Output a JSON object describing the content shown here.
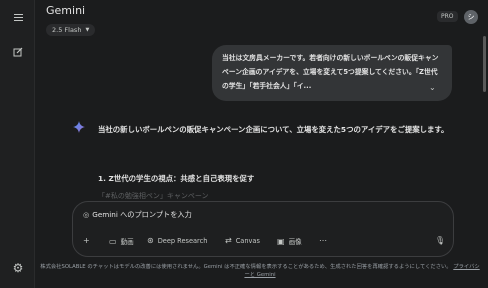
{
  "app": {
    "title": "Gemini",
    "model": "2.5 Flash",
    "plan_badge": "PRO",
    "avatar_initial": "シ"
  },
  "sidebar": {
    "menu_icon": "menu-icon",
    "new_chat_icon": "edit-icon",
    "settings_icon": "gear-icon"
  },
  "conversation": {
    "user_message": "当社は文房具メーカーです。若者向けの新しいボールペンの販促キャンペーン企画のアイデアを、立場を変えて5つ提案してください。「Z世代の学生」「若手社会人」「イ...",
    "response_intro": "当社の新しいボールペンの販促キャンペーン企画について、立場を変えた5つのアイデアをご提案します。",
    "response_heading": "1. Z世代の学生の視点：共感と自己表現を促す",
    "response_faded": "「#私の勉強相ペン」キャンペーン"
  },
  "composer": {
    "placeholder": "Gemini へのプロンプトを入力",
    "tools": [
      {
        "label": "動画",
        "icon": "video-icon"
      },
      {
        "label": "Deep Research",
        "icon": "deep-research-icon"
      },
      {
        "label": "Canvas",
        "icon": "canvas-icon"
      },
      {
        "label": "画像",
        "icon": "image-icon"
      }
    ]
  },
  "footer": {
    "notice": "株式会社SOLABLE のチャットはモデルの改善には使用されません。Gemini は不正確な情報を表示することがあるため、生成された回答を再確認するようにしてください。",
    "privacy_link": "プライバシーと Gemini"
  }
}
